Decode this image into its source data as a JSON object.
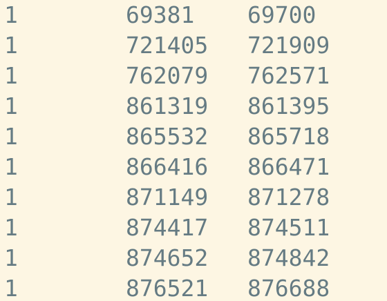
{
  "rows": [
    [
      "1",
      "69381",
      "69700"
    ],
    [
      "1",
      "721405",
      "721909"
    ],
    [
      "1",
      "762079",
      "762571"
    ],
    [
      "1",
      "861319",
      "861395"
    ],
    [
      "1",
      "865532",
      "865718"
    ],
    [
      "1",
      "866416",
      "866471"
    ],
    [
      "1",
      "871149",
      "871278"
    ],
    [
      "1",
      "874417",
      "874511"
    ],
    [
      "1",
      "874652",
      "874842"
    ],
    [
      "1",
      "876521",
      "876688"
    ]
  ],
  "colors": {
    "background": "#fdf6e3",
    "text": "#657b83"
  }
}
